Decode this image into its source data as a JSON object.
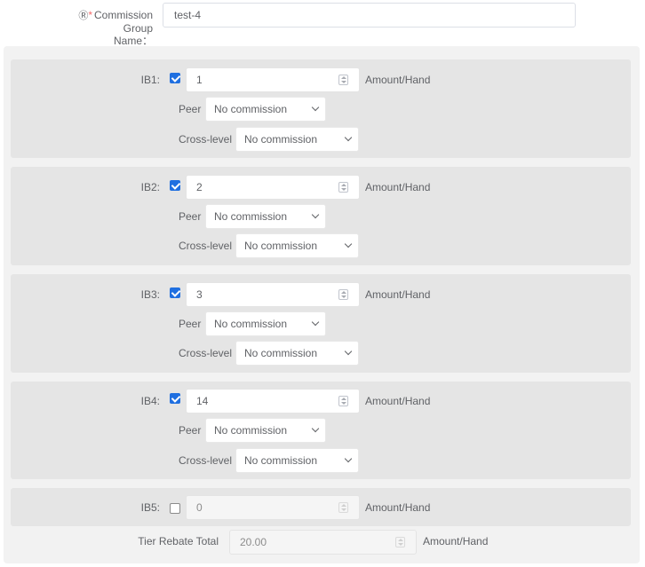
{
  "group_name": {
    "label_icon": "question-circle-icon",
    "required_mark": "*",
    "label_line1": "Commission Group",
    "label_line2": "Name：",
    "value": "test-4"
  },
  "tiers": [
    {
      "label": "IB1:",
      "checked": true,
      "value": "1",
      "unit": "Amount/Hand",
      "peer_label": "Peer",
      "peer_value": "No commission",
      "cross_label": "Cross-level",
      "cross_value": "No commission"
    },
    {
      "label": "IB2:",
      "checked": true,
      "value": "2",
      "unit": "Amount/Hand",
      "peer_label": "Peer",
      "peer_value": "No commission",
      "cross_label": "Cross-level",
      "cross_value": "No commission"
    },
    {
      "label": "IB3:",
      "checked": true,
      "value": "3",
      "unit": "Amount/Hand",
      "peer_label": "Peer",
      "peer_value": "No commission",
      "cross_label": "Cross-level",
      "cross_value": "No commission"
    },
    {
      "label": "IB4:",
      "checked": true,
      "value": "14",
      "unit": "Amount/Hand",
      "peer_label": "Peer",
      "peer_value": "No commission",
      "cross_label": "Cross-level",
      "cross_value": "No commission"
    },
    {
      "label": "IB5:",
      "checked": false,
      "value": "0",
      "unit": "Amount/Hand"
    }
  ],
  "total": {
    "label": "Tier Rebate Total",
    "value": "20.00",
    "unit": "Amount/Hand"
  },
  "colors": {
    "checkbox_checked": "#1f6fe0",
    "required": "#f56c6c",
    "block_bg": "#e5e5e5",
    "outer_bg": "#f2f2f2"
  }
}
